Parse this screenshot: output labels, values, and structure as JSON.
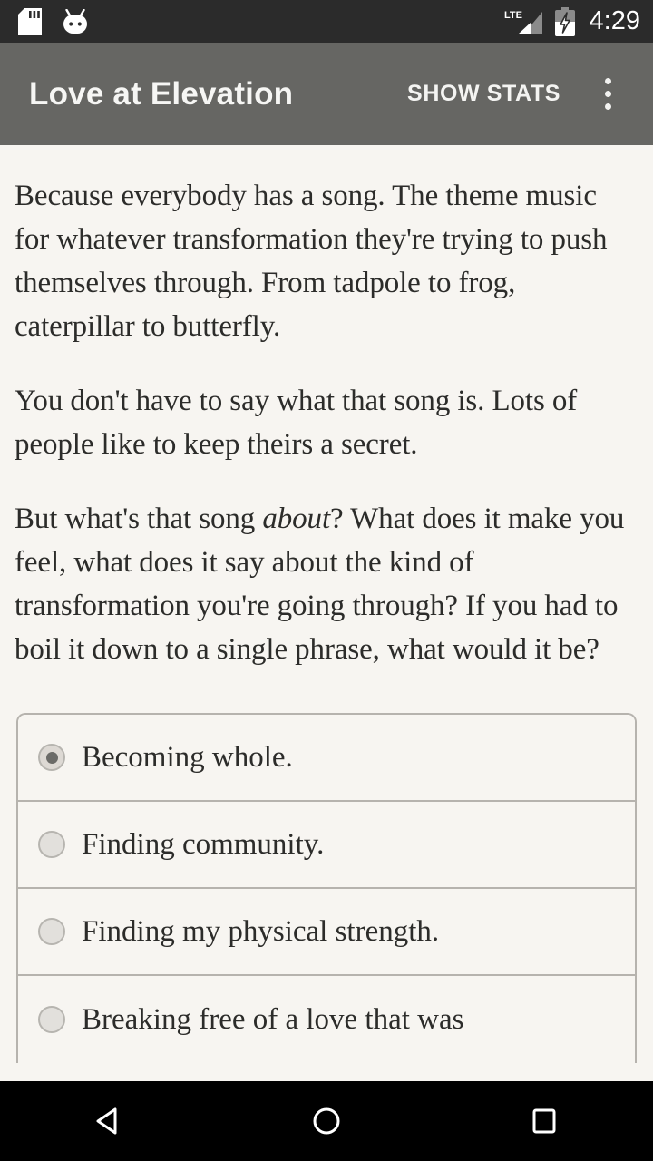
{
  "status_bar": {
    "icons_left": [
      "sd-card-icon",
      "android-head-icon"
    ],
    "network_type": "LTE",
    "icons_right": [
      "signal-bars-icon",
      "battery-charging-icon"
    ],
    "time": "4:29",
    "background_color": "#2b2b2b"
  },
  "app_bar": {
    "title": "Love at Elevation",
    "action_label": "SHOW STATS",
    "overflow_icon": "more-vertical-icon",
    "background_color": "#666663",
    "text_color": "#f6f6f4"
  },
  "content": {
    "background_color": "#f7f5f1",
    "text_color": "#2c2c2a",
    "paragraphs": [
      {
        "id": "p1",
        "text": "Because everybody has a song. The theme music for whatever transformation they're trying to push themselves through. From tadpole to frog, caterpillar to butterfly."
      },
      {
        "id": "p2",
        "text": "You don't have to say what that song is. Lots of people like to keep theirs a secret."
      },
      {
        "id": "p3",
        "before_emphasis": "But what's that song ",
        "emphasis": "about",
        "after_emphasis": "? What does it make you feel, what does it say about the kind of transformation you're going through? If you had to boil it down to a single phrase, what would it be?"
      }
    ]
  },
  "options": {
    "selected_index": 0,
    "items": [
      {
        "label": "Becoming whole.",
        "selected": true
      },
      {
        "label": "Finding community.",
        "selected": false
      },
      {
        "label": "Finding my physical strength.",
        "selected": false
      },
      {
        "label": "Breaking free of a love that was",
        "selected": false
      }
    ]
  },
  "nav_bar": {
    "background_color": "#000000",
    "buttons": [
      {
        "name": "back-button",
        "icon": "back-triangle-icon"
      },
      {
        "name": "home-button",
        "icon": "home-circle-icon"
      },
      {
        "name": "recents-button",
        "icon": "recents-square-icon"
      }
    ]
  }
}
